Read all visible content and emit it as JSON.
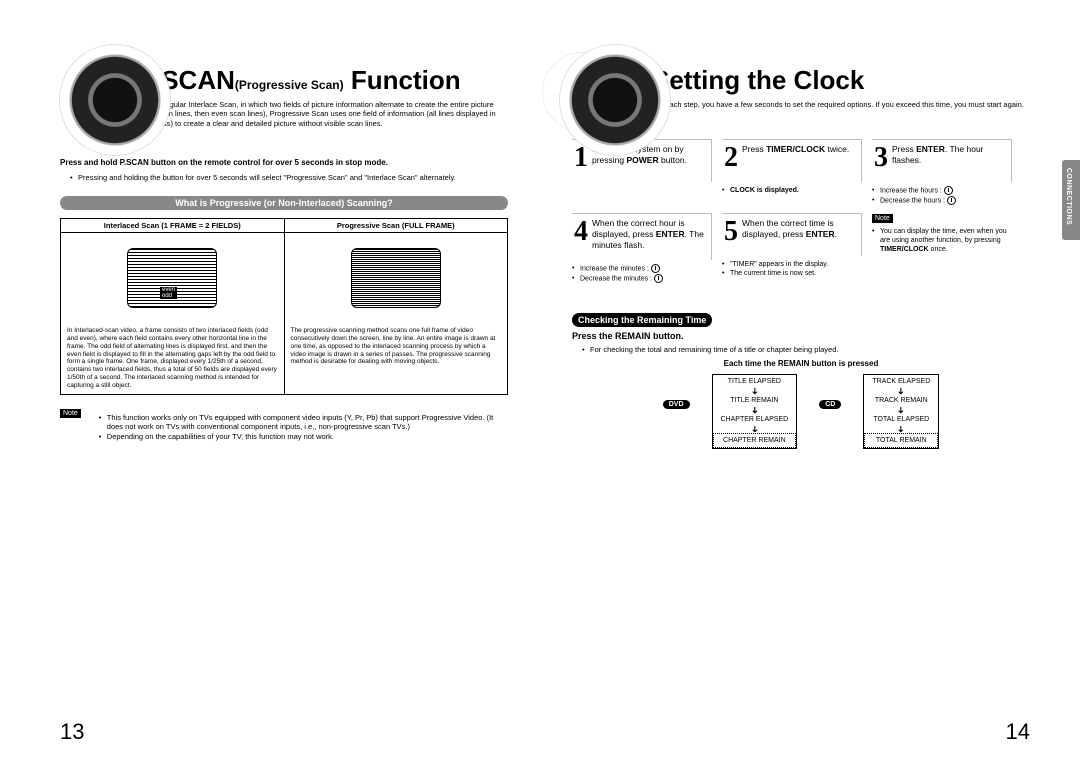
{
  "left": {
    "title_main": "P.SCAN",
    "title_paren": "(Progressive Scan)",
    "title_suffix": " Function",
    "intro": "Unlike regular Interlace Scan, in which two fields of picture information alternate to create the entire picture (odd scan lines, then even scan lines), Progressive Scan uses one field of information (all lines displayed in one pass) to create a clear and detailed picture without visible scan lines.",
    "hold": "Press and hold P.SCAN button on the remote control for over 5 seconds in stop mode.",
    "hold_sub": "Pressing and holding the button for over 5 seconds will select \"Progressive Scan\" and \"Interlace Scan\" alternately.",
    "bar": "What is Progressive (or Non-Interlaced) Scanning?",
    "col1_h": "Interlaced Scan (1 FRAME = 2 FIELDS)",
    "col2_h": "Progressive Scan (FULL FRAME)",
    "field_even": "even",
    "field_odd": "odd",
    "col1_text": "In Interlaced-scan video, a frame consists of two interlaced fields (odd and even), where each field contains every other horizontal line in the frame. The odd field of alternating lines is displayed first, and then the even field is displayed to fill in the alternating gaps left by the odd field to form a single frame. One frame, displayed every 1/25th of a second, contains two interlaced fields, thus a total of 50 fields are displayed every 1/50th of a second. The interlaced scanning method is intended for capturing a still object.",
    "col2_text": "The progressive scanning method scans one full frame of video consecutively down the screen, line by line. An entire image is drawn at one time, as opposed to the interlaced scanning process by which a video image is drawn in a series of passes. The progressive scanning method is desirable for dealing with moving objects.",
    "note_label": "Note",
    "note1": "This function works only on TVs equipped with component video inputs (Y, Pr, Pb) that support Progressive Video. (It does not work on TVs with conventional component inputs, i.e., non-progressive scan TVs.)",
    "note2": "Depending on the capabilities of your TV, this function may not work.",
    "page": "13"
  },
  "right": {
    "title": "Setting the Clock",
    "intro": "For each step, you have a few seconds to set the required options. If you exceed this time, you must start again.",
    "sidetab": "CONNECTIONS",
    "steps": [
      {
        "n": "1",
        "body_a": "Switch the system on by pressing ",
        "body_b": "POWER",
        "body_c": " button.",
        "subs": []
      },
      {
        "n": "2",
        "body_a": "Press ",
        "body_b": "TIMER/CLOCK",
        "body_c": " twice.",
        "subs": [
          "CLOCK is displayed."
        ]
      },
      {
        "n": "3",
        "body_a": "Press ",
        "body_b": "ENTER",
        "body_c": ". The hour flashes.",
        "subs": [
          "Increase the hours :",
          "Decrease the hours :"
        ]
      },
      {
        "n": "4",
        "body_a": "When the correct hour is displayed, press ",
        "body_b": "ENTER",
        "body_c": ". The minutes flash.",
        "subs": [
          "Increase the minutes :",
          "Decrease the minutes :"
        ]
      },
      {
        "n": "5",
        "body_a": "When the correct time is displayed, press ",
        "body_b": "ENTER",
        "body_c": ".",
        "subs": [
          "\"TIMER\" appears in the display.",
          "The current time is now set."
        ]
      }
    ],
    "note_label": "Note",
    "note_a": "You can display the time, even when you are using another function, by pressing ",
    "note_b": "TIMER/CLOCK",
    "note_c": " once.",
    "check_bar": "Checking the Remaining Time",
    "check_sub": "Press the REMAIN button.",
    "check_desc": "For checking the total and remaining time of a title or chapter being played.",
    "each_press": "Each time the REMAIN button is pressed",
    "dvd": "DVD",
    "cd": "CD",
    "flow_dvd": [
      "TITLE ELAPSED",
      "TITLE REMAIN",
      "CHAPTER ELAPSED",
      "CHAPTER REMAIN"
    ],
    "flow_cd": [
      "TRACK ELAPSED",
      "TRACK REMAIN",
      "TOTAL ELAPSED",
      "TOTAL REMAIN"
    ],
    "page": "14"
  }
}
